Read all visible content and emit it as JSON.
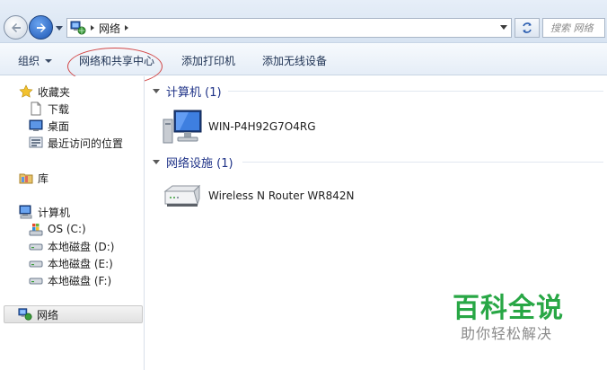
{
  "address_bar": {
    "path": "网络",
    "search_placeholder": "搜索 网络"
  },
  "toolbar": {
    "organize_label": "组织",
    "sharing_center_label": "网络和共享中心",
    "add_printer_label": "添加打印机",
    "add_wireless_label": "添加无线设备"
  },
  "sidebar": {
    "favorites": "收藏夹",
    "downloads": "下载",
    "desktop": "桌面",
    "recent": "最近访问的位置",
    "libraries": "库",
    "computer": "计算机",
    "drive_c": "OS (C:)",
    "drive_d": "本地磁盘 (D:)",
    "drive_e": "本地磁盘 (E:)",
    "drive_f": "本地磁盘 (F:)",
    "network": "网络"
  },
  "content": {
    "computers_group": "计算机 (1)",
    "computer_name": "WIN-P4H92G7O4RG",
    "network_infra_group": "网络设施 (1)",
    "router_name": "Wireless N Router WR842N"
  },
  "watermark": {
    "main": "百科全说",
    "sub": "助你轻松解决"
  },
  "colors": {
    "highlight_ellipse": "#d24848",
    "watermark_green": "#28a745",
    "group_header": "#1e3287"
  }
}
